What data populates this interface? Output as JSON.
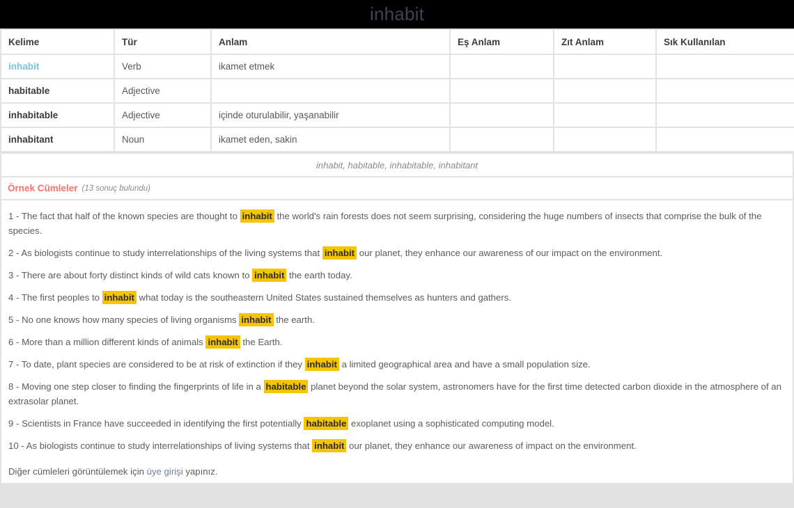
{
  "header": {
    "title": "inhabit",
    "title_color": "#3c4456",
    "bar_color": "#000000"
  },
  "word_table": {
    "columns": [
      "Kelime",
      "Tür",
      "Anlam",
      "Eş Anlam",
      "Zıt Anlam",
      "Sık Kullanılan"
    ],
    "rows": [
      {
        "kelime": "inhabit",
        "tur": "Verb",
        "anlam": "ikamet etmek",
        "es_anlam": "",
        "zit_anlam": "",
        "sik_kullanilan": "",
        "is_link": true
      },
      {
        "kelime": "habitable",
        "tur": "Adjective",
        "anlam": "",
        "es_anlam": "",
        "zit_anlam": "",
        "sik_kullanilan": "",
        "is_link": false
      },
      {
        "kelime": "inhabitable",
        "tur": "Adjective",
        "anlam": "içinde oturulabilir, yaşanabilir",
        "es_anlam": "",
        "zit_anlam": "",
        "sik_kullanilan": "",
        "is_link": false
      },
      {
        "kelime": "inhabitant",
        "tur": "Noun",
        "anlam": "ikamet eden, sakin",
        "es_anlam": "",
        "zit_anlam": "",
        "sik_kullanilan": "",
        "is_link": false
      }
    ]
  },
  "forms_row": {
    "text": "inhabit, habitable, inhabitable, inhabitant"
  },
  "examples": {
    "title": "Örnek Cümleler",
    "count_text": "(13 sonuç bulundu)",
    "title_color": "#fa7268",
    "highlight_color": "#f6c500",
    "sentences": [
      {
        "number": "1 - ",
        "parts": [
          {
            "text": "The fact that half of the known species are thought to ",
            "highlight": false
          },
          {
            "text": "inhabit",
            "highlight": true
          },
          {
            "text": " the world's rain forests does not seem surprising, considering the huge numbers of insects that comprise the bulk of the species.",
            "highlight": false
          }
        ]
      },
      {
        "number": "2 - ",
        "parts": [
          {
            "text": "As biologists continue to study interrelationships of the living systems that ",
            "highlight": false
          },
          {
            "text": "inhabit",
            "highlight": true
          },
          {
            "text": " our planet, they enhance our awareness of our impact on the environment.",
            "highlight": false
          }
        ]
      },
      {
        "number": "3 - ",
        "parts": [
          {
            "text": "There are about forty distinct kinds of wild cats known to ",
            "highlight": false
          },
          {
            "text": "inhabit",
            "highlight": true
          },
          {
            "text": " the earth today.",
            "highlight": false
          }
        ]
      },
      {
        "number": "4 - ",
        "parts": [
          {
            "text": "The first peoples to ",
            "highlight": false
          },
          {
            "text": "inhabit",
            "highlight": true
          },
          {
            "text": " what today is the southeastern United States sustained themselves as hunters and gathers.",
            "highlight": false
          }
        ]
      },
      {
        "number": "5 - ",
        "parts": [
          {
            "text": "No one knows how many species of living organisms ",
            "highlight": false
          },
          {
            "text": "inhabit",
            "highlight": true
          },
          {
            "text": " the earth.",
            "highlight": false
          }
        ]
      },
      {
        "number": "6 - ",
        "parts": [
          {
            "text": "More than a million different kinds of animals ",
            "highlight": false
          },
          {
            "text": "inhabit",
            "highlight": true
          },
          {
            "text": " the Earth.",
            "highlight": false
          }
        ]
      },
      {
        "number": "7 - ",
        "parts": [
          {
            "text": "To date, plant species are considered to be at risk of extinction if they ",
            "highlight": false
          },
          {
            "text": "inhabit",
            "highlight": true
          },
          {
            "text": " a limited geographical area and have a small population size.",
            "highlight": false
          }
        ]
      },
      {
        "number": "8 - ",
        "parts": [
          {
            "text": "Moving one step closer to finding the fingerprints of life in a ",
            "highlight": false
          },
          {
            "text": "habitable",
            "highlight": true
          },
          {
            "text": " planet beyond the solar system, astronomers have for the first time detected carbon dioxide in the atmosphere of an extrasolar planet.",
            "highlight": false
          }
        ]
      },
      {
        "number": "9 - ",
        "parts": [
          {
            "text": "Scientists in France have succeeded in identifying the first potentially ",
            "highlight": false
          },
          {
            "text": "habitable",
            "highlight": true
          },
          {
            "text": " exoplanet using a sophisticated computing model.",
            "highlight": false
          }
        ]
      },
      {
        "number": "10 - ",
        "parts": [
          {
            "text": "As biologists continue to study interrelationships of living systems that ",
            "highlight": false
          },
          {
            "text": "inhabit",
            "highlight": true
          },
          {
            "text": " our planet, they enhance our awareness of impact on the environment.",
            "highlight": false
          }
        ]
      }
    ],
    "login_note": {
      "before": "Diğer cümleleri görüntülemek için ",
      "link": "üye girişi",
      "after": " yapınız."
    }
  }
}
